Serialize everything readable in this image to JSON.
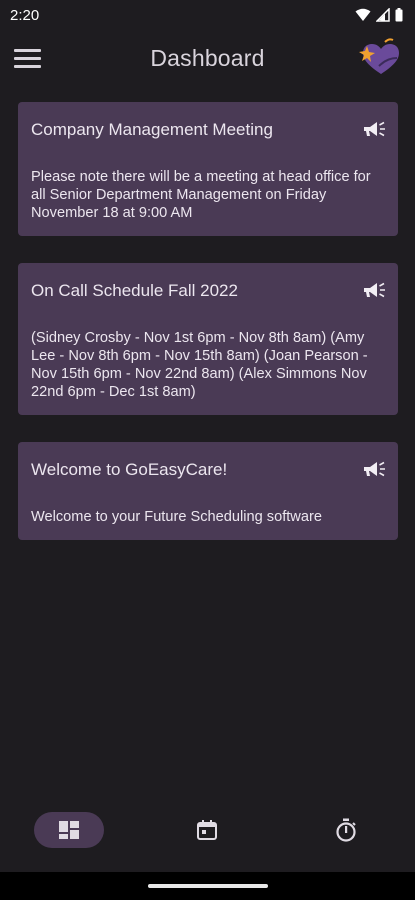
{
  "status_bar": {
    "time": "2:20"
  },
  "app_bar": {
    "title": "Dashboard"
  },
  "cards": [
    {
      "title": "Company Management Meeting",
      "body": "Please note there will be a meeting at head office for all Senior Department Management on Friday November 18 at 9:00 AM",
      "icon": "megaphone-icon"
    },
    {
      "title": "On Call Schedule Fall 2022",
      "body": "(Sidney Crosby - Nov 1st 6pm - Nov 8th 8am) (Amy Lee - Nov 8th 6pm - Nov 15th 8am) (Joan Pearson - Nov 15th 6pm - Nov 22nd 8am) (Alex Simmons Nov 22nd 6pm - Dec 1st 8am)",
      "icon": "megaphone-icon"
    },
    {
      "title": "Welcome to GoEasyCare!",
      "body": "Welcome to your Future Scheduling software",
      "icon": "megaphone-icon"
    }
  ],
  "bottom_nav": [
    {
      "icon": "dashboard-icon",
      "active": true
    },
    {
      "icon": "calendar-icon",
      "active": false
    },
    {
      "icon": "timer-icon",
      "active": false
    }
  ],
  "colors": {
    "background": "#1e1c20",
    "card": "#4a3a55",
    "text": "#ece6ef",
    "logo_primary": "#6a4a9a",
    "logo_accent": "#f0a030"
  }
}
